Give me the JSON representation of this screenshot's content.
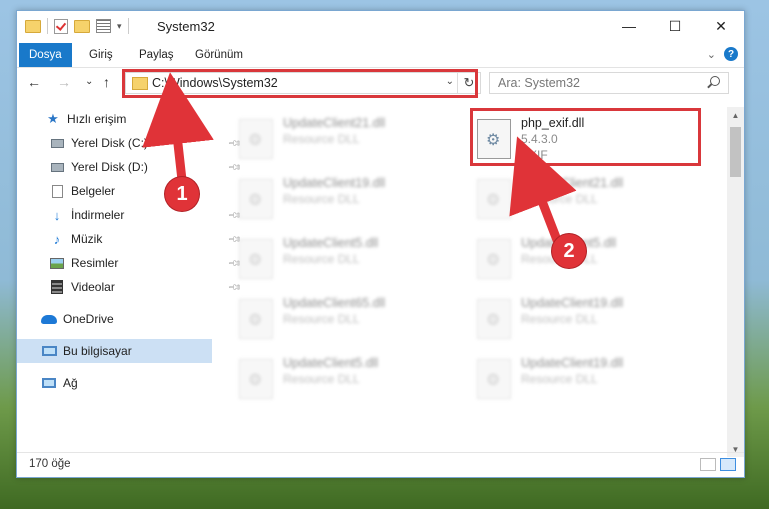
{
  "window": {
    "title": "System32",
    "buttons": {
      "minimize": "—",
      "maximize": "☐",
      "close": "✕"
    }
  },
  "ribbon": {
    "tabs": [
      "Dosya",
      "Giriş",
      "Paylaş",
      "Görünüm"
    ],
    "active_tab": "Dosya",
    "help": "?"
  },
  "nav": {
    "back": "←",
    "forward": "→",
    "recent": "⌄",
    "up": "↑"
  },
  "address": {
    "path": "C:\\Windows\\System32",
    "refresh": "↻"
  },
  "search": {
    "placeholder": "Ara: System32"
  },
  "sidebar": {
    "items": [
      {
        "label": "Hızlı erişim",
        "icon": "star-icon"
      },
      {
        "label": "Yerel Disk (C:)",
        "icon": "drive-icon"
      },
      {
        "label": "Yerel Disk (D:)",
        "icon": "drive-icon"
      },
      {
        "label": "Belgeler",
        "icon": "documents-icon"
      },
      {
        "label": "İndirmeler",
        "icon": "downloads-icon"
      },
      {
        "label": "Müzik",
        "icon": "music-icon"
      },
      {
        "label": "Resimler",
        "icon": "pictures-icon"
      },
      {
        "label": "Videolar",
        "icon": "videos-icon"
      },
      {
        "label": "OneDrive",
        "icon": "onedrive-icon"
      },
      {
        "label": "Bu bilgisayar",
        "icon": "computer-icon"
      },
      {
        "label": "Ağ",
        "icon": "network-icon"
      }
    ],
    "selected": "Bu bilgisayar"
  },
  "files": {
    "left": [
      {
        "name": "UpdateClient21.dll",
        "type": "Resource DLL"
      },
      {
        "name": "UpdateClient19.dll",
        "type": "Resource DLL"
      },
      {
        "name": "UpdateClient5.dll",
        "type": "Resource DLL"
      },
      {
        "name": "UpdateClient65.dll",
        "type": "Resource DLL"
      },
      {
        "name": "UpdateClient5.dll",
        "type": "Resource DLL"
      }
    ],
    "right": [
      {
        "name": "php_exif.dll",
        "version": "5.4.3.0",
        "desc": "EXIF"
      },
      {
        "name": "UpdateClient21.dll",
        "type": "Resource DLL"
      },
      {
        "name": "UpdateClient5.dll",
        "type": "Resource DLL"
      },
      {
        "name": "UpdateClient19.dll",
        "type": "Resource DLL"
      },
      {
        "name": "UpdateClient19.dll",
        "type": "Resource DLL"
      }
    ]
  },
  "status": {
    "item_count": "170 öğe"
  },
  "annotations": {
    "step1": "1",
    "step2": "2",
    "color": "#e03338"
  }
}
